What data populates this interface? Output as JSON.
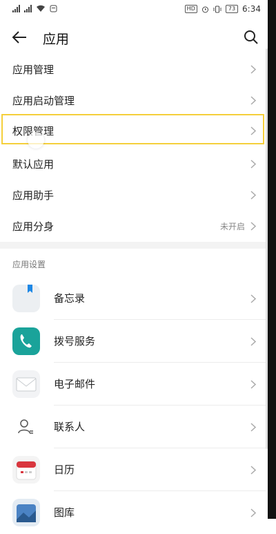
{
  "status": {
    "left_text": "ᴴᴰ",
    "time": "6:34",
    "battery": "73",
    "chip1": "HD"
  },
  "header": {
    "title": "应用"
  },
  "menu": [
    {
      "label": "应用管理",
      "value": ""
    },
    {
      "label": "应用启动管理",
      "value": ""
    },
    {
      "label": "权限管理",
      "value": ""
    },
    {
      "label": "默认应用",
      "value": ""
    },
    {
      "label": "应用助手",
      "value": ""
    },
    {
      "label": "应用分身",
      "value": "未开启"
    }
  ],
  "section": {
    "title": "应用设置"
  },
  "apps": [
    {
      "label": "备忘录",
      "icon": "memo-icon"
    },
    {
      "label": "拨号服务",
      "icon": "phone-icon"
    },
    {
      "label": "电子邮件",
      "icon": "email-icon"
    },
    {
      "label": "联系人",
      "icon": "contact-icon"
    },
    {
      "label": "日历",
      "icon": "calendar-icon"
    },
    {
      "label": "图库",
      "icon": "gallery-icon"
    }
  ],
  "colors": {
    "highlight": "#f5cf3b",
    "phone": "#1aa39a",
    "calendar": "#d9363e"
  }
}
